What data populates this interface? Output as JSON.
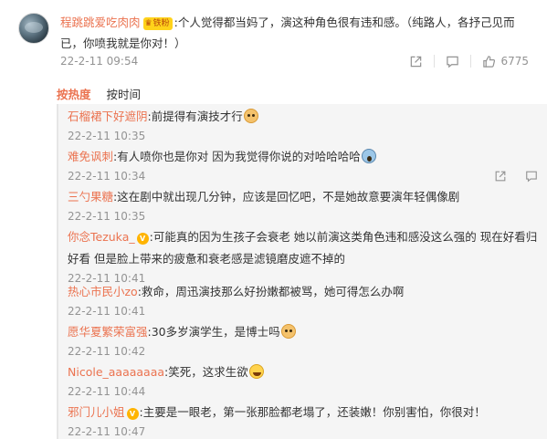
{
  "main_comment": {
    "username": "程跳跳爱吃肉肉",
    "badge_label": "铁粉",
    "text": ":个人觉得都当妈了，演这种角色很有违和感。（纯路人，各抒己见而已，你喷我就是你对！）",
    "time": "22-2-11 09:54",
    "like_count": "6775",
    "icons": [
      "share-icon",
      "comment-icon",
      "like-icon"
    ]
  },
  "sort_tabs": {
    "hot": "按热度",
    "time": "按时间"
  },
  "replies": [
    {
      "user": "石榴裙下好遮阴",
      "text": ":前提得有演技才行",
      "time": "22-2-11 10:35",
      "emoji": "doge-emoji"
    },
    {
      "user": "难免讽刺",
      "text": ":有人喷你也是你对 因为我觉得你说的对哈哈哈哈",
      "time": "22-2-11 10:34",
      "emoji": "scream-emoji"
    },
    {
      "user": "三勺果糖",
      "text": ":这在剧中就出现几分钟，应该是回忆吧，不是她故意要演年轻偶像剧",
      "time": "22-2-11 10:35"
    },
    {
      "user": "你念Tezuka_",
      "text": ":可能真的因为生孩子会衰老 她以前演这类角色违和感没这么强的 现在好看归好看 但是脸上带来的疲惫和衰老感是滤镜磨皮遮不掉的",
      "time": "22-2-11 10:41",
      "vip": true
    },
    {
      "user": "热心市民小zo",
      "text": ":救命，周迅演技那么好扮嫩都被骂，她可得怎么办啊",
      "time": "22-2-11 10:41"
    },
    {
      "user": "愿华夏繁荣富强",
      "text": ":30多岁演学生，是博士吗",
      "time": "22-2-11 10:42",
      "emoji": "doge-emoji"
    },
    {
      "user": "Nicole_aaaaaaaa",
      "text": ":笑死，这求生欲",
      "time": "22-2-11 10:44",
      "emoji": "laugh-emoji"
    },
    {
      "user": "邪门儿小姐",
      "text": ":主要是一眼老，第一张那脸都老塌了，还装嫩！你别害怕，你很对！",
      "time": "22-2-11 10:47",
      "vip": true
    }
  ],
  "colors": {
    "username": "#eb7350",
    "time": "#939393",
    "reply_bg": "#f5f5f5"
  }
}
